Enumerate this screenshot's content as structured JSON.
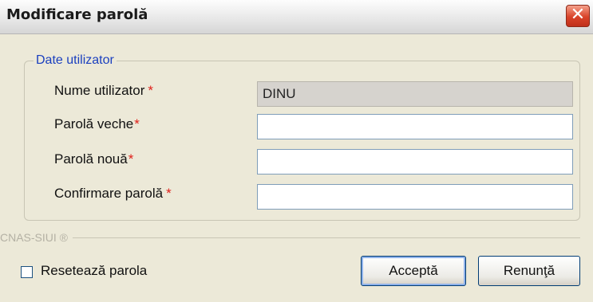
{
  "window": {
    "title": "Modificare parolă",
    "close_glyph": "✕"
  },
  "group": {
    "legend": "Date utilizator"
  },
  "fields": [
    {
      "label": "Nume utilizator",
      "required_mark": "*",
      "value": "DINU",
      "readonly": true
    },
    {
      "label": "Parolă veche",
      "required_mark": "*",
      "value": ""
    },
    {
      "label": "Parolă nouă",
      "required_mark": "*",
      "value": ""
    },
    {
      "label": "Confirmare parolă",
      "required_mark": "*",
      "value": ""
    }
  ],
  "footer": {
    "brand": "CNAS-SIUI ®"
  },
  "reset": {
    "label": "Resetează parola",
    "checked": false
  },
  "buttons": {
    "accept": "Acceptă",
    "cancel": "Renunţă"
  },
  "colors": {
    "required": "#e0201a",
    "legend": "#1a3fbf",
    "close_button": "#d9432a"
  }
}
